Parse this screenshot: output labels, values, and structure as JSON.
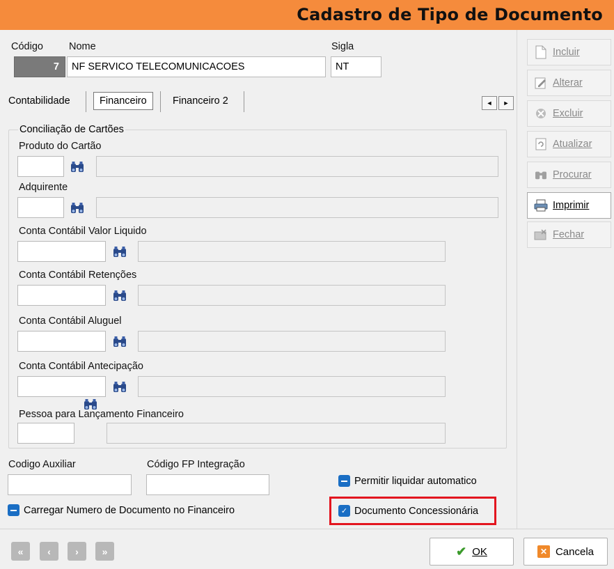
{
  "window": {
    "title": "Cadastro de Tipo de Documento"
  },
  "header_fields": {
    "codigo_label": "Código",
    "codigo_value": "7",
    "nome_label": "Nome",
    "nome_value": "NF SERVICO TELECOMUNICACOES",
    "sigla_label": "Sigla",
    "sigla_value": "NT"
  },
  "tabs": [
    {
      "label": "Contabilidade",
      "active": false
    },
    {
      "label": "Financeiro",
      "active": true
    },
    {
      "label": "Financeiro 2",
      "active": false
    }
  ],
  "tab_nav": {
    "prev": "◄",
    "next": "►"
  },
  "group": {
    "title": "Conciliação de Cartões",
    "fields": [
      {
        "label": "Produto do Cartão",
        "code": "",
        "description": ""
      },
      {
        "label": "Adquirente",
        "code": "",
        "description": ""
      },
      {
        "label": "Conta Contábil Valor Liquido",
        "code": "",
        "description": ""
      },
      {
        "label": "Conta Contábil Retenções",
        "code": "",
        "description": ""
      },
      {
        "label": "Conta Contábil Aluguel",
        "code": "",
        "description": ""
      },
      {
        "label": "Conta Contábil Antecipação",
        "code": "",
        "description": ""
      },
      {
        "label": "Pessoa para Lançamento Financeiro",
        "code": "",
        "description": ""
      }
    ]
  },
  "bottom_fields": {
    "codigo_auxiliar_label": "Codigo Auxiliar",
    "codigo_auxiliar_value": "",
    "codigo_fp_label": "Código FP Integração",
    "codigo_fp_value": ""
  },
  "checkboxes": {
    "permitir_liquidar": {
      "label": "Permitir liquidar automatico",
      "checked": false
    },
    "carregar_numero": {
      "label": "Carregar Numero de Documento no Financeiro",
      "checked": false
    },
    "documento_concessionaria": {
      "label": "Documento Concessionária",
      "checked": true
    }
  },
  "side_buttons": [
    {
      "label": "Incluir",
      "icon": "document-icon",
      "enabled": false
    },
    {
      "label": "Alterar",
      "icon": "edit-icon",
      "enabled": false
    },
    {
      "label": "Excluir",
      "icon": "delete-icon",
      "enabled": false
    },
    {
      "label": "Atualizar",
      "icon": "refresh-icon",
      "enabled": false
    },
    {
      "label": "Procurar",
      "icon": "binoculars-icon",
      "enabled": false
    },
    {
      "label": "Imprimir",
      "icon": "printer-icon",
      "enabled": true
    },
    {
      "label": "Fechar",
      "icon": "close-folder-icon",
      "enabled": false
    }
  ],
  "nav_buttons": {
    "first": "«",
    "prev": "‹",
    "next": "›",
    "last": "»"
  },
  "actions": {
    "ok_label": "OK",
    "cancel_label": "Cancela"
  },
  "colors": {
    "title_bar": "#f58b3c",
    "checkbox": "#1a6ec4",
    "highlight": "#e3151f"
  }
}
